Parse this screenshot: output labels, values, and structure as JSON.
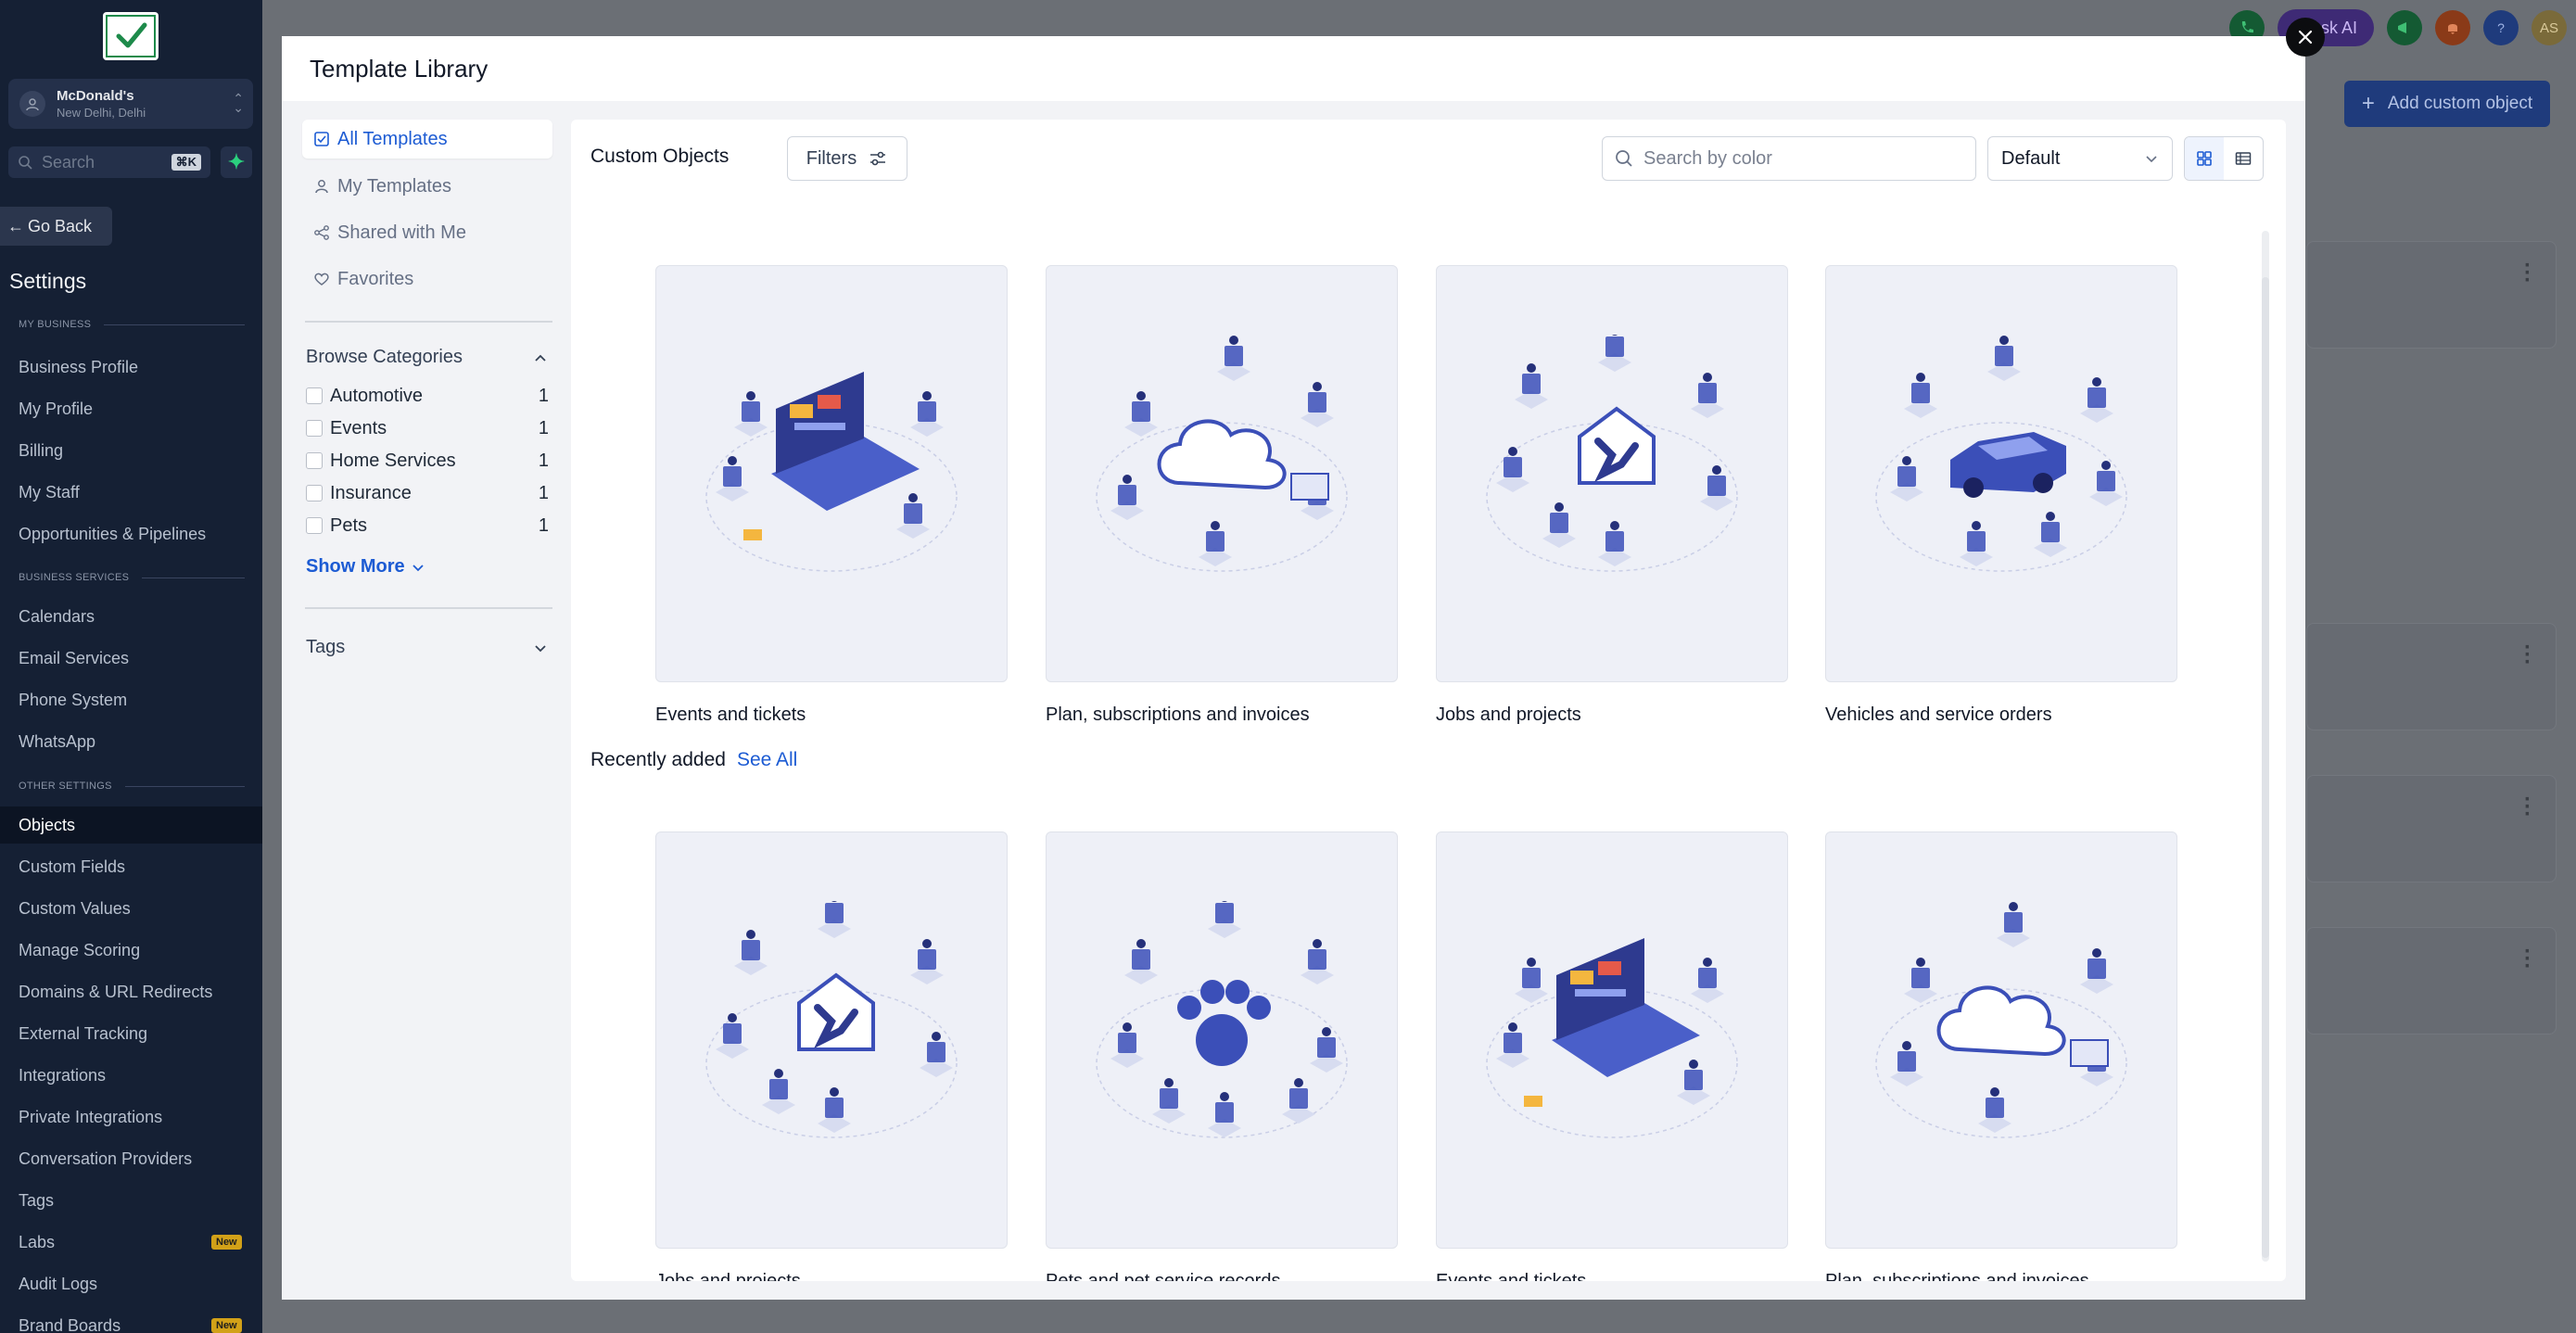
{
  "sidebar": {
    "location": {
      "name": "McDonald's",
      "city": "New Delhi, Delhi"
    },
    "search": {
      "placeholder": "Search",
      "shortcut": "⌘K"
    },
    "go_back": "Go Back",
    "settings_title": "Settings",
    "sections": [
      {
        "title": "MY BUSINESS",
        "items": [
          "Business Profile",
          "My Profile",
          "Billing",
          "My Staff",
          "Opportunities & Pipelines"
        ]
      },
      {
        "title": "BUSINESS SERVICES",
        "items": [
          "Calendars",
          "Email Services",
          "Phone System",
          "WhatsApp"
        ]
      },
      {
        "title": "OTHER SETTINGS",
        "items": [
          "Objects",
          "Custom Fields",
          "Custom Values",
          "Manage Scoring",
          "Domains & URL Redirects",
          "External Tracking",
          "Integrations",
          "Private Integrations",
          "Conversation Providers",
          "Tags",
          "Labs",
          "Audit Logs",
          "Brand Boards"
        ]
      }
    ],
    "active_item": "Objects",
    "new_badge": "New"
  },
  "background": {
    "ask_ai": "Ask AI",
    "avatar": "AS",
    "add_custom_object": "Add custom object"
  },
  "modal": {
    "title": "Template Library",
    "nav": [
      "All Templates",
      "My Templates",
      "Shared with Me",
      "Favorites"
    ],
    "browse_categories": "Browse Categories",
    "categories": [
      {
        "label": "Automotive",
        "count": "1"
      },
      {
        "label": "Events",
        "count": "1"
      },
      {
        "label": "Home Services",
        "count": "1"
      },
      {
        "label": "Insurance",
        "count": "1"
      },
      {
        "label": "Pets",
        "count": "1"
      }
    ],
    "show_more": "Show More",
    "tags": "Tags",
    "content": {
      "title": "Custom Objects",
      "filters": "Filters",
      "search_placeholder": "Search by color",
      "sort": "Default",
      "custom_objects": [
        {
          "name": "Events and tickets",
          "illustration": "laptop-events-icon"
        },
        {
          "name": "Plan, subscriptions and invoices",
          "illustration": "cloud-subscriptions-icon"
        },
        {
          "name": "Jobs and projects",
          "illustration": "house-tools-icon"
        },
        {
          "name": "Vehicles and service orders",
          "illustration": "car-service-icon"
        }
      ],
      "recently_added_title": "Recently added",
      "see_all": "See All",
      "recently_added": [
        {
          "name": "Jobs and projects",
          "illustration": "house-tools-icon"
        },
        {
          "name": "Pets and pet service records",
          "illustration": "paw-pets-icon"
        },
        {
          "name": "Events and tickets",
          "illustration": "laptop-events-icon"
        },
        {
          "name": "Plan, subscriptions and invoices",
          "illustration": "cloud-subscriptions-icon"
        }
      ]
    }
  },
  "colors": {
    "primary": "#1c5bd3",
    "illustration": "#3b4fb8",
    "sidebar": "#152034"
  }
}
